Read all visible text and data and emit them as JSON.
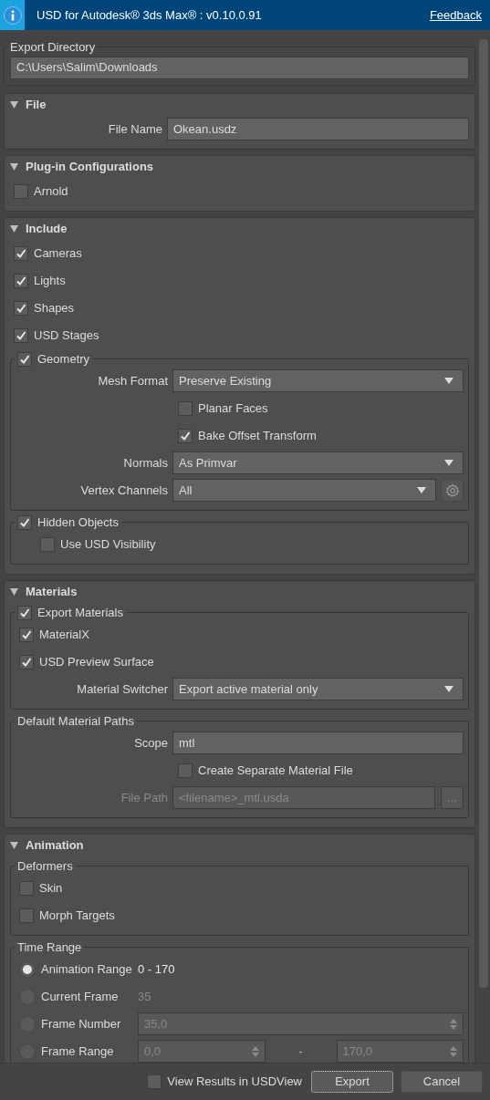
{
  "window": {
    "title": "USD for Autodesk® 3ds Max® : v0.10.0.91",
    "link": "Feedback"
  },
  "export_directory": {
    "label": "Export Directory",
    "value": "C:\\Users\\Salim\\Downloads"
  },
  "sections": [
    {
      "title": "File",
      "expanded": true,
      "rows": [
        {
          "kind": "field",
          "label": "File Name",
          "value": "Okean.usdz",
          "disabled": false
        }
      ]
    },
    {
      "title": "Plug-in Configurations",
      "expanded": true,
      "rows": [
        {
          "kind": "checkbox",
          "label": "Arnold",
          "checked": false
        }
      ]
    },
    {
      "title": "Include",
      "expanded": true,
      "rows": [
        {
          "kind": "checkbox",
          "label": "Cameras",
          "checked": true
        },
        {
          "kind": "checkbox",
          "label": "Lights",
          "checked": true
        },
        {
          "kind": "checkbox",
          "label": "Shapes",
          "checked": true
        },
        {
          "kind": "checkbox",
          "label": "USD Stages",
          "checked": true
        },
        {
          "kind": "group",
          "label": "Geometry",
          "checked": true,
          "rows": [
            {
              "kind": "dropdown",
              "label": "Mesh Format",
              "value": "Preserve Existing",
              "has_settings": false
            },
            {
              "kind": "form_checkbox",
              "label": "Planar Faces",
              "checked": false
            },
            {
              "kind": "form_checkbox",
              "label": "Bake Offset Transform",
              "checked": true
            },
            {
              "kind": "dropdown",
              "label": "Normals",
              "value": "As Primvar",
              "has_settings": false
            },
            {
              "kind": "dropdown",
              "label": "Vertex Channels",
              "value": "All",
              "has_settings": true
            }
          ]
        },
        {
          "kind": "group",
          "label": "Hidden Objects",
          "checked": true,
          "rows": [
            {
              "kind": "indented_checkbox",
              "label": "Use USD Visibility",
              "checked": false
            }
          ]
        }
      ]
    },
    {
      "title": "Materials",
      "expanded": true,
      "rows": [
        {
          "kind": "group",
          "label": "Export Materials",
          "checked": true,
          "rows": [
            {
              "kind": "checkbox",
              "label": "MaterialX",
              "checked": true
            },
            {
              "kind": "checkbox",
              "label": "USD Preview Surface",
              "checked": true
            },
            {
              "kind": "dropdown",
              "label": "Material Switcher",
              "value": "Export active material only",
              "has_settings": false
            }
          ]
        },
        {
          "kind": "group",
          "label": "Default Material Paths",
          "rows": [
            {
              "kind": "field",
              "label": "Scope",
              "value": "mtl",
              "disabled": false
            },
            {
              "kind": "form_checkbox",
              "label": "Create Separate Material File",
              "checked": false
            },
            {
              "kind": "field",
              "label": "File Path",
              "value": "<filename>_mtl.usda",
              "disabled": true,
              "button": "..."
            }
          ]
        }
      ]
    },
    {
      "title": "Animation",
      "expanded": true,
      "rows": [
        {
          "kind": "group",
          "label": "Deformers",
          "rows": [
            {
              "kind": "checkbox",
              "label": "Skin",
              "checked": false
            },
            {
              "kind": "checkbox",
              "label": "Morph Targets",
              "checked": false
            }
          ]
        },
        {
          "kind": "group",
          "label": "Time Range",
          "rows": [
            {
              "kind": "radio",
              "label": "Animation Range",
              "selected": true,
              "value": "0 - 170",
              "disabled": false
            },
            {
              "kind": "radio",
              "label": "Current Frame",
              "selected": false,
              "value": "35",
              "disabled": true
            },
            {
              "kind": "radio",
              "label": "Frame Number",
              "selected": false,
              "spinners": [
                "35,0"
              ],
              "disabled": true
            },
            {
              "kind": "radio",
              "label": "Frame Range",
              "selected": false,
              "spinners": [
                "0,0",
                "170,0"
              ],
              "separator": "-",
              "disabled": true
            }
          ]
        }
      ]
    }
  ],
  "footer": {
    "checkbox": {
      "label": "View Results in USDView",
      "checked": false
    },
    "buttons": [
      {
        "label": "Export",
        "focused": true
      },
      {
        "label": "Cancel",
        "focused": false
      }
    ]
  }
}
